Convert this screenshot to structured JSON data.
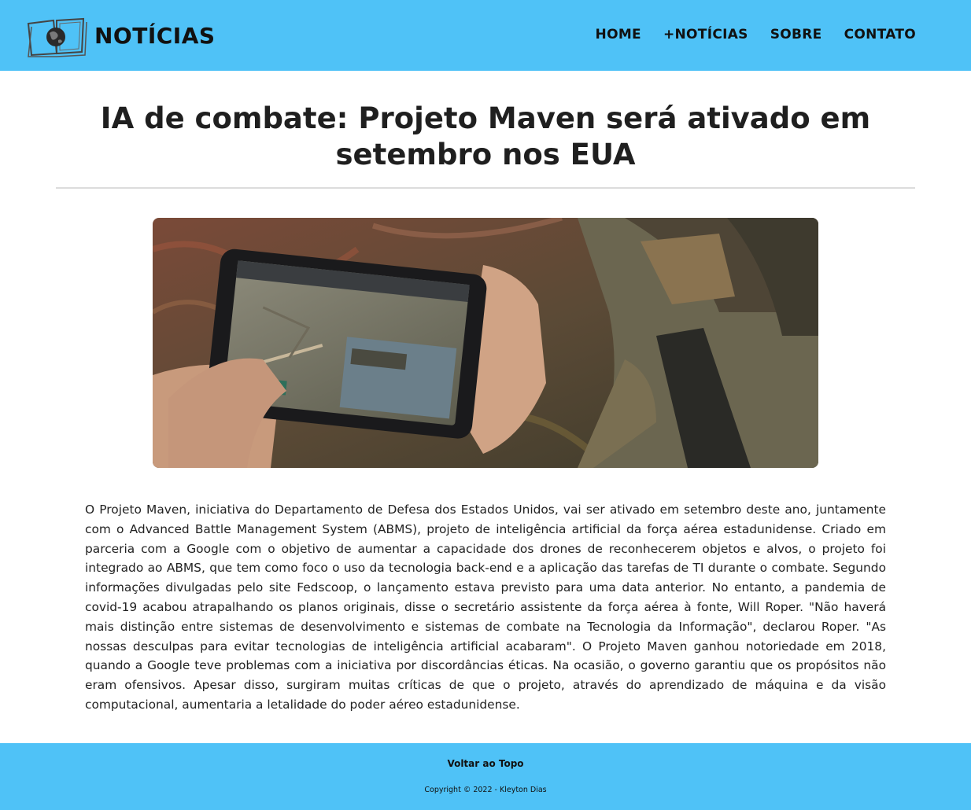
{
  "site": {
    "logo_text": "NOTÍCIAS",
    "logo_icon": "globe-book-icon"
  },
  "nav": {
    "items": [
      "HOME",
      "+NOTÍCIAS",
      "SOBRE",
      "CONTATO"
    ]
  },
  "article": {
    "title": "IA de combate: Projeto Maven será ativado em setembro nos EUA",
    "body": "O Projeto Maven, iniciativa do Departamento de Defesa dos Estados Unidos, vai ser ativado em setembro deste ano, juntamente com o Advanced Battle Management System (ABMS), projeto de inteligência artificial da força aérea estadunidense. Criado em parceria com a Google com o objetivo de aumentar a capacidade dos drones de reconhecerem objetos e alvos, o projeto foi integrado ao ABMS, que tem como foco o uso da tecnologia back-end e a aplicação das tarefas de TI durante o combate. Segundo informações divulgadas pelo site Fedscoop, o lançamento estava previsto para uma data anterior. No entanto, a pandemia de covid-19 acabou atrapalhando os planos originais, disse o secretário assistente da força aérea à fonte, Will Roper. \"Não haverá mais distinção entre sistemas de desenvolvimento e sistemas de combate na Tecnologia da Informação\", declarou Roper. \"As nossas desculpas para evitar tecnologias de inteligência artificial acabaram\". O Projeto Maven ganhou notoriedade em 2018, quando a Google teve problemas com a iniciativa por discordâncias éticas. Na ocasião, o governo garantiu que os propósitos não eram ofensivos. Apesar disso, surgiram muitas críticas de que o projeto, através do aprendizado de máquina e da visão computacional, aumentaria a letalidade do poder aéreo estadunidense."
  },
  "footer": {
    "back_to_top": "Voltar ao Topo",
    "copyright": "Copyright © 2022 - Kleyton Dias"
  },
  "colors": {
    "header_bg": "#4fc2f7",
    "footer_bg": "#4fc2f7",
    "text": "#222222"
  }
}
